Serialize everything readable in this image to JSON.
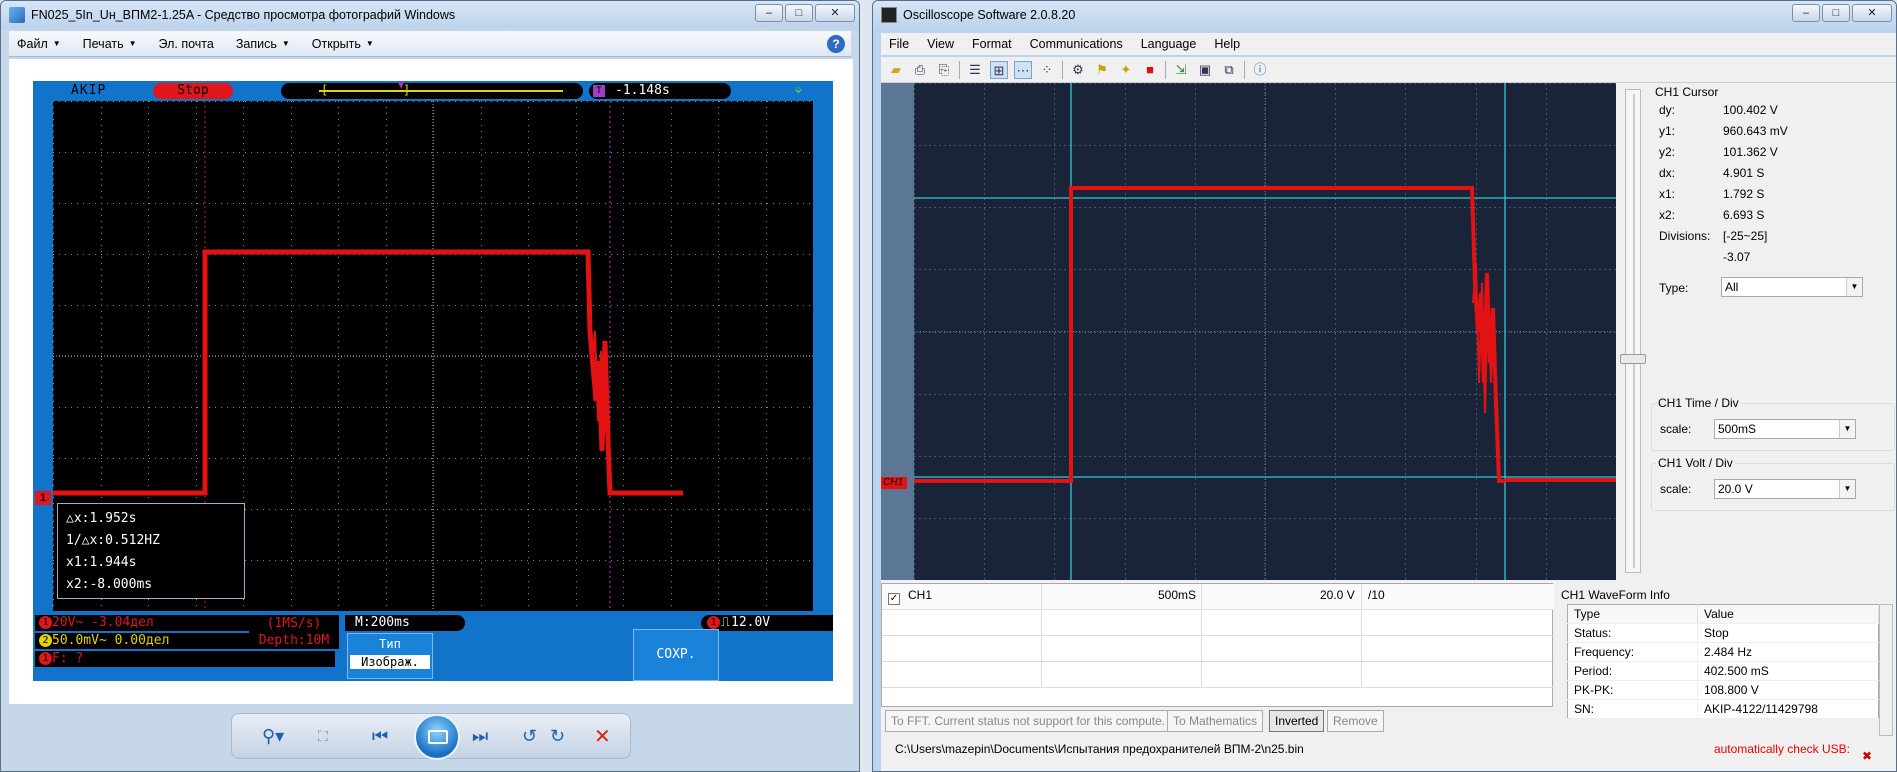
{
  "photo_viewer": {
    "title": "FN025_5In_Uн_ВПМ2-1.25A - Средство просмотра фотографий Windows",
    "menu": [
      {
        "label": "Файл",
        "dropdown": true
      },
      {
        "label": "Печать",
        "dropdown": true
      },
      {
        "label": "Эл. почта",
        "dropdown": false
      },
      {
        "label": "Запись",
        "dropdown": true
      },
      {
        "label": "Открыть",
        "dropdown": true
      }
    ],
    "help": "?",
    "caption_buttons": [
      "‒",
      "□",
      "✕"
    ]
  },
  "scope_image": {
    "brand": "AKIP",
    "status": "Stop",
    "trigger_time": "-1.148s",
    "measure": [
      "△x:1.952s",
      "1/△x:0.512HZ",
      "x1:1.944s",
      "x2:-8.000ms"
    ],
    "ch1_line": "20V~   -3.04дел",
    "ch2_line": "50.0mV~  0.00дел",
    "f_line": "F:  ?",
    "sample_rate": "(1MS/s)",
    "depth": "Depth:10M",
    "timebase": "M:200ms",
    "trigger_level": "12.0V",
    "type_btn_l1": "Тип",
    "type_btn_l2": "Изображ.",
    "save_btn": "СОХР.",
    "ch1_mark": "1",
    "ch1_num": "1",
    "ch2_num": "2",
    "trig_num": "1",
    "t_icon": "T",
    "trig_slope": "⎍"
  },
  "oscilloscope": {
    "title": "Oscilloscope Software 2.0.8.20",
    "menu": [
      "File",
      "View",
      "Format",
      "Communications",
      "Language",
      "Help"
    ],
    "cursor_title": "CH1 Cursor",
    "cursor": [
      {
        "k": "dy:",
        "v": "100.402 V"
      },
      {
        "k": "y1:",
        "v": "960.643 mV"
      },
      {
        "k": "y2:",
        "v": "101.362 V"
      },
      {
        "k": "dx:",
        "v": "4.901 S"
      },
      {
        "k": "x1:",
        "v": "1.792 S"
      },
      {
        "k": "x2:",
        "v": "6.693 S"
      },
      {
        "k": "Divisions:",
        "v": "[-25~25]"
      },
      {
        "k": "",
        "v": "-3.07"
      }
    ],
    "type_label": "Type:",
    "type_value": "All",
    "time_div_title": "CH1 Time / Div",
    "time_scale_label": "scale:",
    "time_scale_value": "500mS",
    "volt_div_title": "CH1 Volt / Div",
    "volt_scale_label": "scale:",
    "volt_scale_value": "20.0 V",
    "ch_tag": "CH1",
    "table_row": {
      "name": "CH1",
      "time": "500mS",
      "volt": "20.0 V",
      "probe": "/10"
    },
    "buttons": [
      {
        "label": "To FFT. Current status not support for this compute.",
        "enabled": false
      },
      {
        "label": "To Mathematics",
        "enabled": false
      },
      {
        "label": "Inverted",
        "enabled": true
      },
      {
        "label": "Remove",
        "enabled": false
      }
    ],
    "waveform_title": "CH1 WaveForm Info",
    "waveform_header": [
      "Type",
      "Value"
    ],
    "waveform": [
      {
        "k": "Status:",
        "v": "Stop"
      },
      {
        "k": "Frequency:",
        "v": "2.484 Hz"
      },
      {
        "k": "Period:",
        "v": "402.500 mS"
      },
      {
        "k": "PK-PK:",
        "v": "108.800 V"
      },
      {
        "k": "SN:",
        "v": "AKIP-4122/11429798"
      }
    ],
    "path": "C:\\Users\\mazepin\\Documents\\Испытания предохранителей ВПМ-2\\n25.bin",
    "auto_usb": "automatically check USB:"
  },
  "colors": {
    "trace": "#e31313",
    "grid_cyan": "#34c6d8",
    "scope_blue": "#1173c9"
  }
}
